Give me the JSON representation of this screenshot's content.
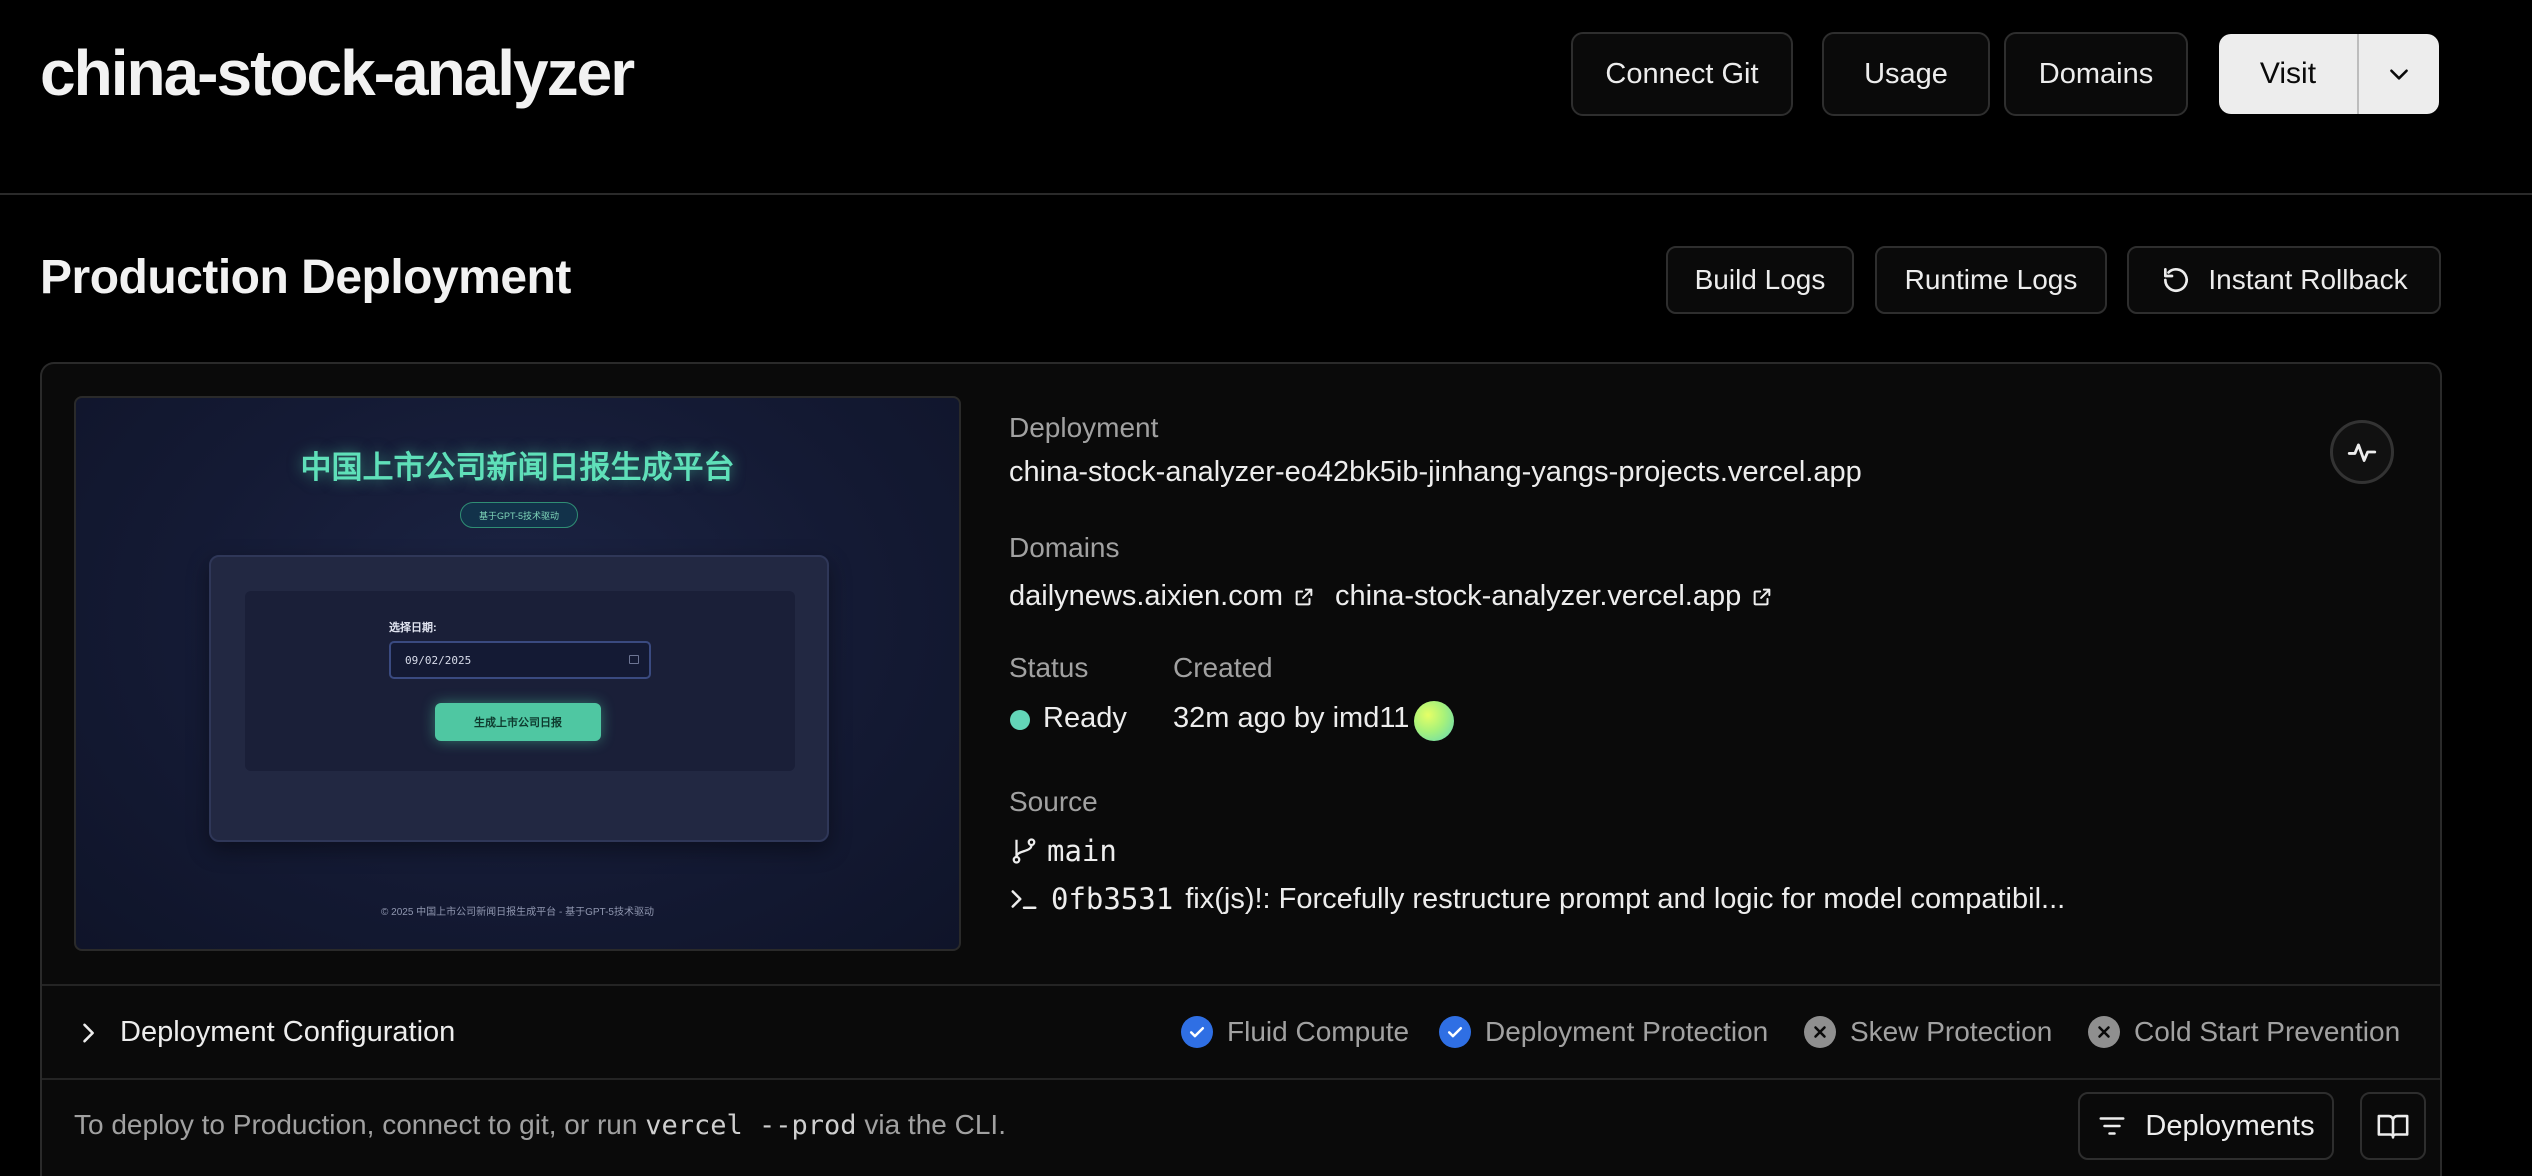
{
  "header": {
    "project_title": "china-stock-analyzer",
    "connect_git": "Connect Git",
    "usage": "Usage",
    "domains": "Domains",
    "visit": "Visit"
  },
  "section": {
    "title": "Production Deployment",
    "build_logs": "Build Logs",
    "runtime_logs": "Runtime Logs",
    "instant_rollback": "Instant Rollback"
  },
  "preview": {
    "title": "中国上市公司新闻日报生成平台",
    "badge": "基于GPT-5技术驱动",
    "date_label": "选择日期:",
    "date_value": "09/02/2025",
    "generate_button": "生成上市公司日报",
    "footer": "© 2025 中国上市公司新闻日报生成平台 - 基于GPT-5技术驱动"
  },
  "deployment": {
    "label": "Deployment",
    "url": "china-stock-analyzer-eo42bk5ib-jinhang-yangs-projects.vercel.app",
    "domains_label": "Domains",
    "domains": [
      "dailynews.aixien.com",
      "china-stock-analyzer.vercel.app"
    ],
    "status_label": "Status",
    "status_value": "Ready",
    "status_color": "#63d6b8",
    "created_label": "Created",
    "created_value": "32m ago by imd11",
    "source_label": "Source",
    "branch": "main",
    "commit_hash": "0fb3531",
    "commit_message": "fix(js)!: Forcefully restructure prompt and logic for model compatibil..."
  },
  "config": {
    "title": "Deployment Configuration",
    "features": [
      {
        "label": "Fluid Compute",
        "enabled": true
      },
      {
        "label": "Deployment Protection",
        "enabled": true
      },
      {
        "label": "Skew Protection",
        "enabled": false
      },
      {
        "label": "Cold Start Prevention",
        "enabled": false
      }
    ]
  },
  "footer": {
    "cli_prefix": "To deploy to Production, connect to git, or run ",
    "cli_command": "vercel --prod",
    "cli_suffix": " via the CLI.",
    "deployments_button": "Deployments"
  },
  "colors": {
    "background": "#000000",
    "accent_blue": "#2f6fe4",
    "ready_green": "#63d6b8"
  }
}
